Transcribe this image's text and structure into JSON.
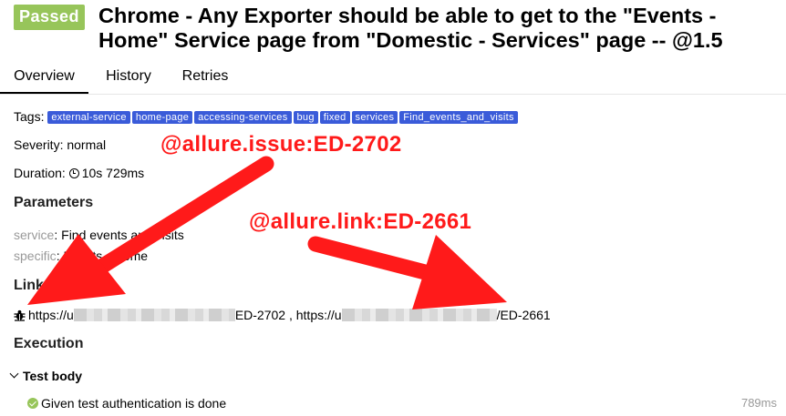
{
  "header": {
    "status": "Passed",
    "title": "Chrome - Any Exporter should be able to get to the \"Events - Home\" Service page from \"Domestic - Services\" page -- @1.5"
  },
  "tabs": [
    {
      "label": "Overview",
      "active": true
    },
    {
      "label": "History",
      "active": false
    },
    {
      "label": "Retries",
      "active": false
    }
  ],
  "tags": {
    "label": "Tags:",
    "items": [
      "external-service",
      "home-page",
      "accessing-services",
      "bug",
      "fixed",
      "services",
      "Find_events_and_visits"
    ]
  },
  "severity": {
    "text": "Severity: normal"
  },
  "duration": {
    "label": "Duration:",
    "value": "10s 729ms"
  },
  "parameters": {
    "heading": "Parameters",
    "items": [
      {
        "name": "service",
        "value": "Find events and visits"
      },
      {
        "name": "specific",
        "value": "Events - Home"
      }
    ]
  },
  "links": {
    "heading": "Links",
    "issue_prefix": "https://u",
    "issue_suffix": "ED-2702",
    "separator": " , ",
    "link_prefix": "https://u",
    "link_suffix": "/ED-2661"
  },
  "execution": {
    "heading": "Execution",
    "test_body": "Test body",
    "steps": [
      {
        "name": "Given test authentication is done",
        "duration": "789ms",
        "status": "passed"
      }
    ]
  },
  "annotations": {
    "issue": "@allure.issue:ED-2702",
    "link": "@allure.link:ED-2661",
    "color": "#ff1a1a"
  },
  "colors": {
    "passed": "#97c55a",
    "tag": "#3a5bd9"
  }
}
